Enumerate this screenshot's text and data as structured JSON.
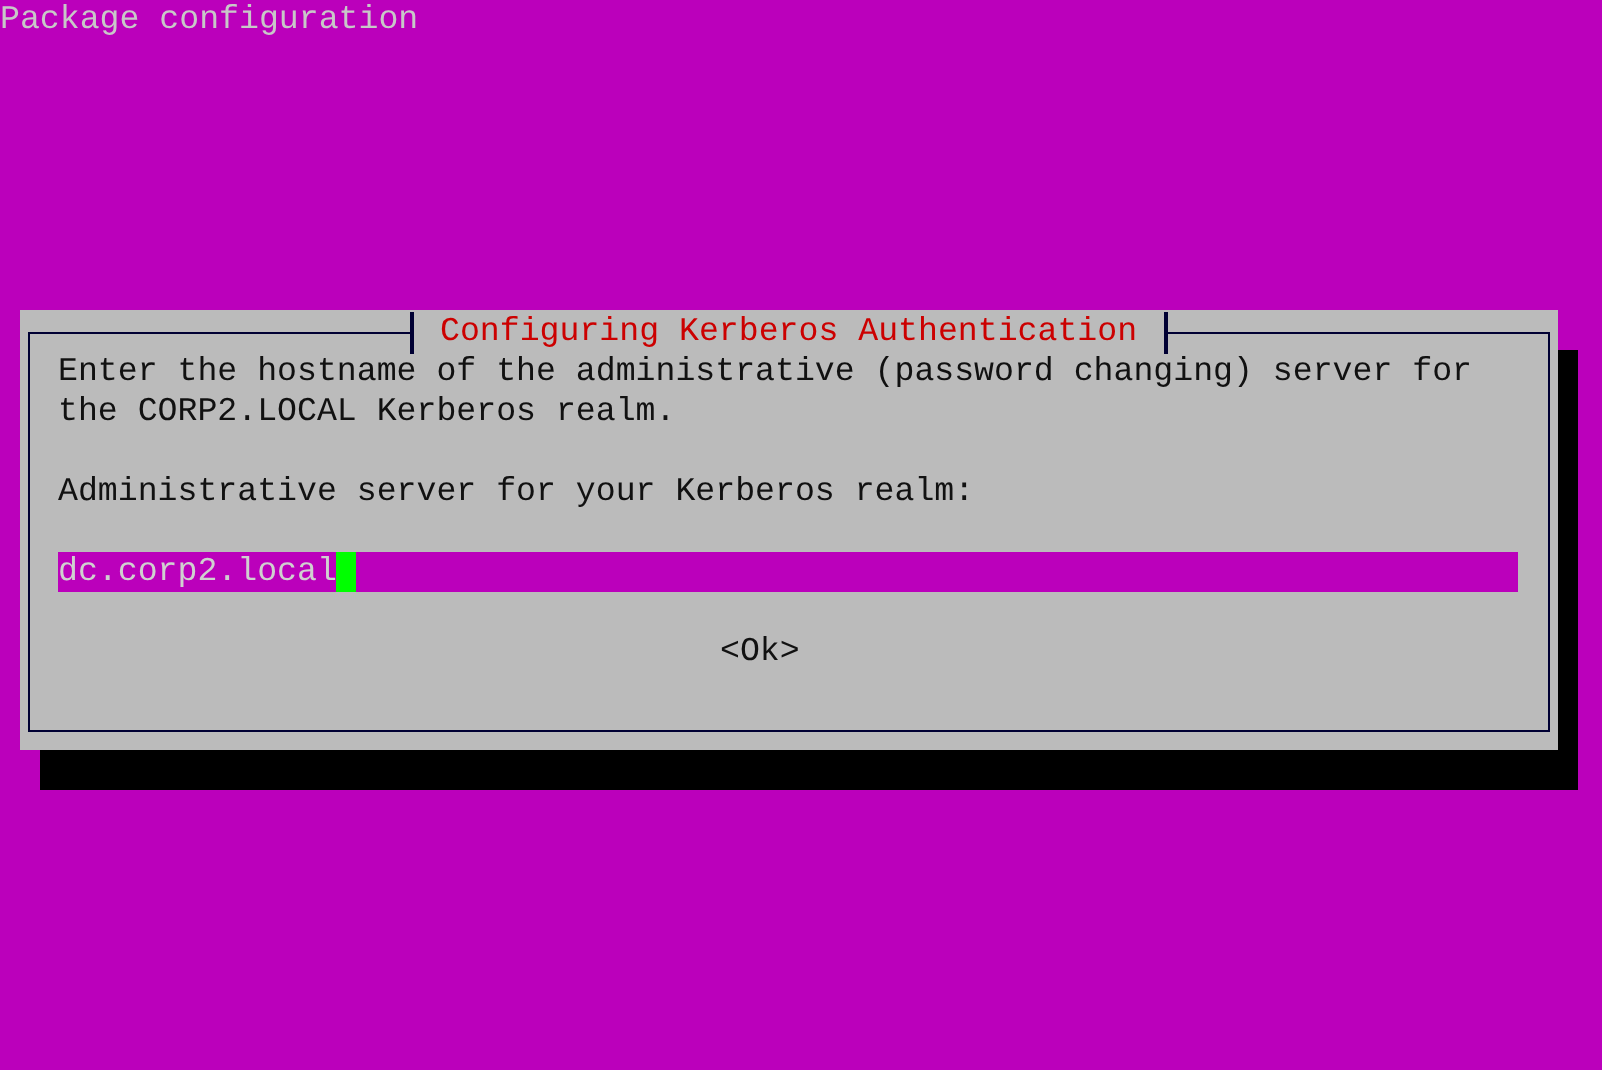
{
  "header": "Package configuration",
  "dialog": {
    "title": "Configuring Kerberos Authentication",
    "description_lines": [
      "Enter the hostname of the administrative (password changing) server for",
      "the CORP2.LOCAL Kerberos realm."
    ],
    "prompt": "Administrative server for your Kerberos realm:",
    "input": {
      "value": "dc.corp2.local",
      "focused": true
    },
    "buttons": [
      {
        "label": "<Ok>",
        "selected": false
      }
    ]
  }
}
